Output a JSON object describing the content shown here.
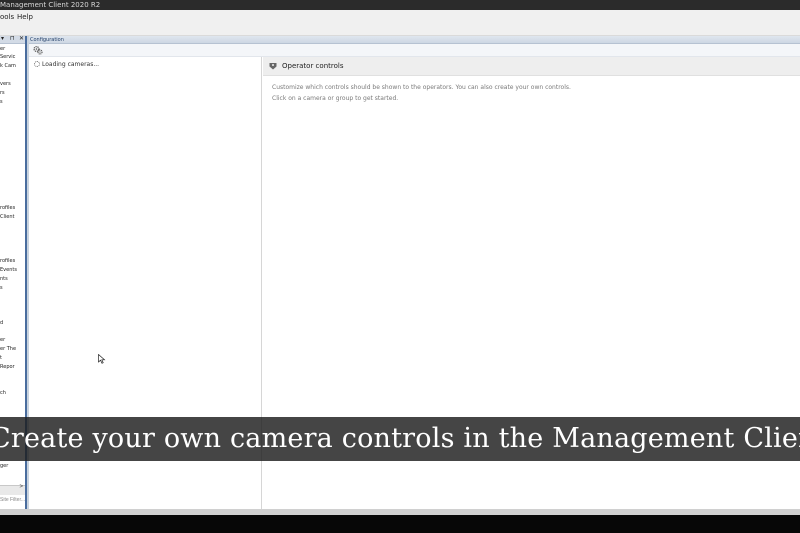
{
  "window": {
    "title": "Management Client 2020 R2"
  },
  "menu": {
    "items": [
      "ools",
      "Help"
    ]
  },
  "nav": {
    "controls": [
      "▾",
      "⊓",
      "✕"
    ],
    "lines": [
      "er",
      "Servic",
      "k Cam",
      "vers",
      "rs",
      "s",
      "rofiles",
      "Client",
      "rofiles",
      "Events",
      "nts",
      "s",
      "d",
      "er",
      "er The",
      "t",
      "Repor",
      "ch",
      "ger"
    ],
    "site_filter": "Site Filter..."
  },
  "config": {
    "header": "Configuration",
    "toolbar_icon": "gear-group-icon",
    "camera_list": {
      "loading_text": "Loading cameras..."
    },
    "operator": {
      "title": "Operator controls",
      "description_line1": "Customize which controls should be shown to the operators. You can also create your own controls.",
      "description_line2": "Click on a camera or group to get started.",
      "icon": "controller-icon"
    }
  },
  "caption": {
    "text": "Create your own camera controls in the Management Client"
  },
  "colors": {
    "accent": "#4a6d9e",
    "caption_band": "#1c1c1c",
    "panel_bg": "#ffffff"
  }
}
